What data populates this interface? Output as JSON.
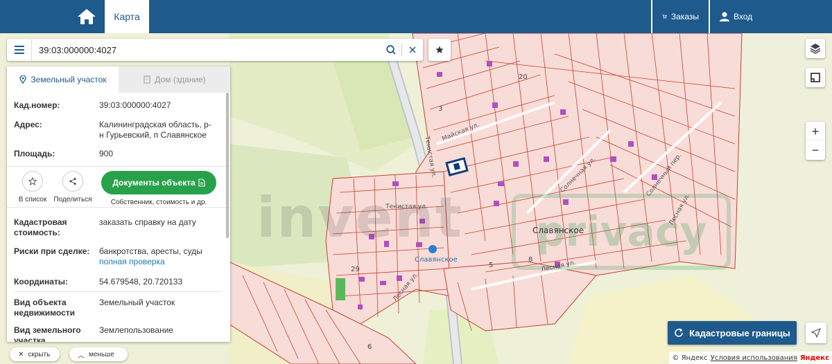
{
  "topbar": {
    "home_icon": "home-icon",
    "tab_map": "Карта",
    "orders_label": "Заказы",
    "login_label": "Вход"
  },
  "search": {
    "value": "39:03:000000:4027"
  },
  "panel": {
    "tab_land": "Земельный участок",
    "tab_house": "Дом (здание)",
    "rows": {
      "kad_label": "Кад.номер:",
      "kad_value": "39:03:000000:4027",
      "addr_label": "Адрес:",
      "addr_value": "Калининградская область, р-н Гурьевский, п Славянское",
      "area_label": "Площадь:",
      "area_value": "900",
      "cost_label": "Кадастровая стоимость:",
      "cost_link": "заказать справку на дату",
      "risk_label": "Риски при сделке:",
      "risk_value": "банкротства, аресты, суды",
      "risk_link": "полная проверка",
      "coords_label": "Координаты:",
      "coords_value": "54.679548, 20.720133",
      "objtype_label": "Вид объекта недвижимости",
      "objtype_value": "Земельный участок",
      "landtype_label": "Вид земельного участка",
      "landtype_value": "Землепользование"
    },
    "actions": {
      "to_list": "В список",
      "share": "Поделиться",
      "docs_button": "Документы объекта",
      "docs_sub": "Собственник, стоимость и др."
    }
  },
  "bottom": {
    "hide_label": "скрыть",
    "less_label": "меньше"
  },
  "kad_button": "Кадастровые границы",
  "map": {
    "place_name": "Славянское",
    "poi_name": "Славянское",
    "streets": {
      "mayskaya": "Майская ул.",
      "tenistaya_v": "Тенистая ул.",
      "tenistaya": "Тенистая ул.",
      "solnechnaya": "Солнечная ул.",
      "solnechny_per": "Солнечный пер.",
      "lesnaya_r": "Лесная ул.",
      "lesnaya_l": "Лесная ул.",
      "lesnaya_e": "Лесная ул."
    },
    "numbers": [
      "20",
      "3",
      "29",
      "5",
      "8",
      "6"
    ],
    "watermark": "invent",
    "watermark2": "privacy"
  },
  "copyright": {
    "text": "© Яндекс",
    "terms": "Условия использования",
    "brand": "Яндекс"
  },
  "colors": {
    "brand_blue": "#1e5a8c",
    "green_button": "#27a24a",
    "parcel_fill": "#f6d6d2",
    "parcel_stroke": "#c8412c",
    "building": "#b04fc0"
  }
}
